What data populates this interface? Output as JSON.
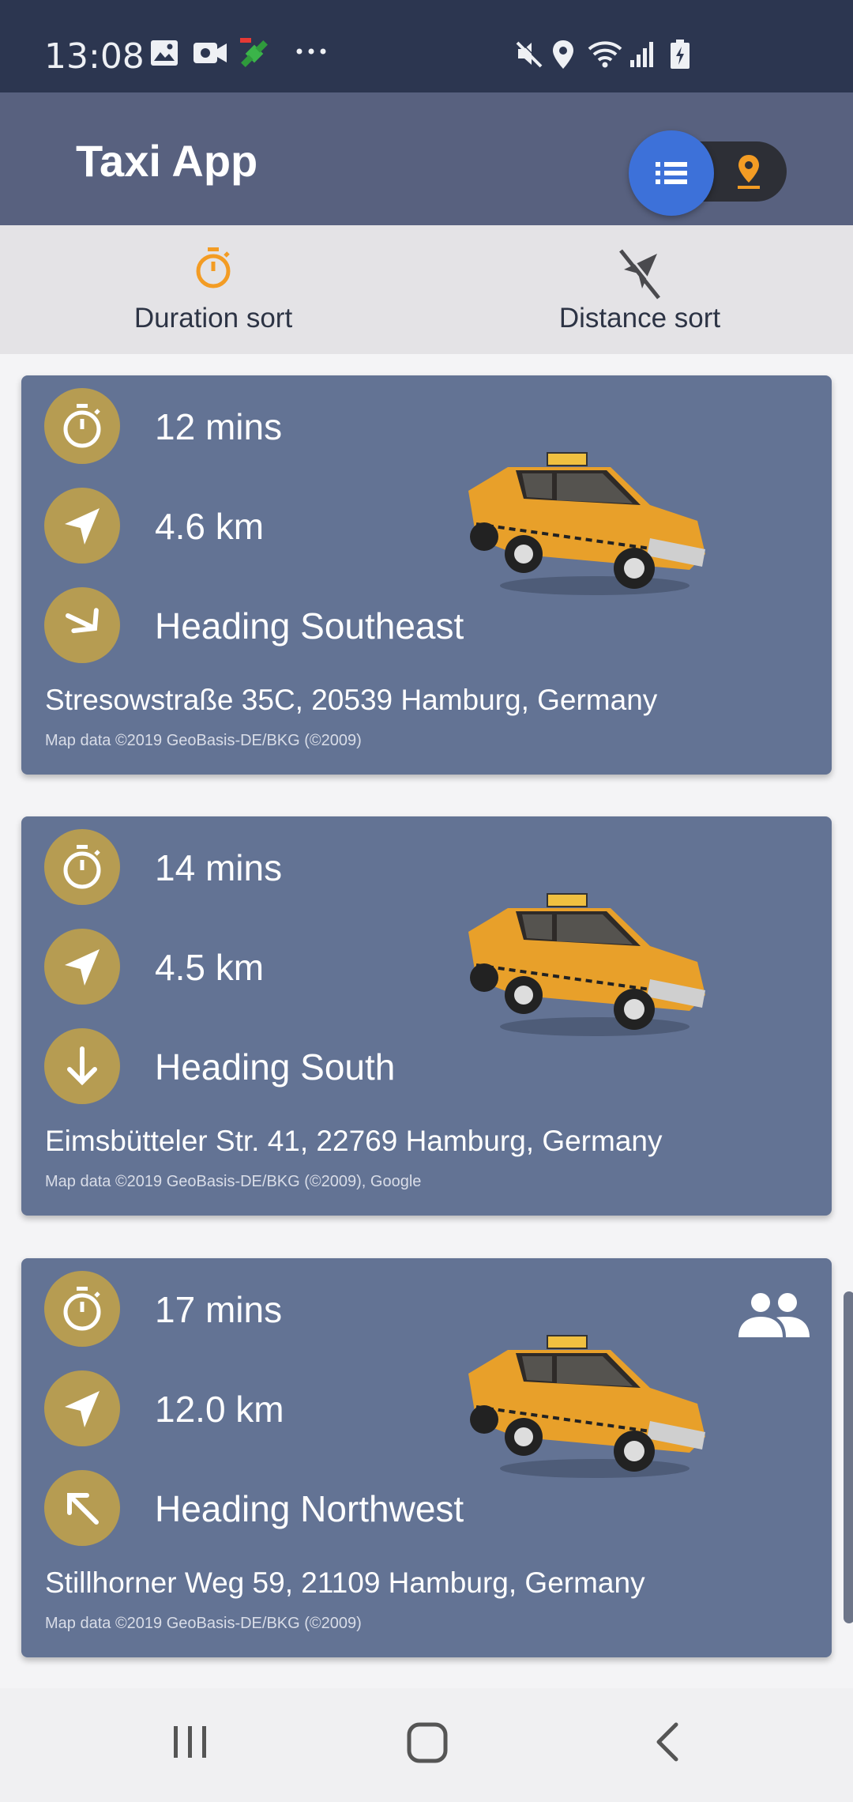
{
  "status_bar": {
    "time": "13:08",
    "left_icons": [
      "gallery-icon",
      "video-camera-icon",
      "satellite-icon",
      "more-dots-icon"
    ],
    "right_icons": [
      "mute-icon",
      "location-icon",
      "wifi-icon",
      "signal-icon",
      "battery-icon"
    ]
  },
  "app_bar": {
    "title": "Taxi App",
    "toggle": {
      "active": "list",
      "options": [
        "list-icon",
        "map-pin-icon"
      ]
    }
  },
  "sort": {
    "duration_label": "Duration sort",
    "distance_label": "Distance sort"
  },
  "colors": {
    "app_bar": "#58617f",
    "status_bar": "#2c3650",
    "card": "#637394",
    "circle": "#b69c52",
    "toggle_knob": "#3d71d9",
    "accent_orange": "#f39c24"
  },
  "taxis": [
    {
      "duration": "12 mins",
      "distance": "4.6 km",
      "heading": "Heading Southeast",
      "address": "Stresowstraße 35C, 20539 Hamburg, Germany",
      "credit": "Map data ©2019 GeoBasis-DE/BKG (©2009)",
      "group_icon": false
    },
    {
      "duration": "14 mins",
      "distance": "4.5 km",
      "heading": "Heading South",
      "address": "Eimsbütteler Str. 41, 22769 Hamburg, Germany",
      "credit": "Map data ©2019 GeoBasis-DE/BKG (©2009), Google",
      "group_icon": false
    },
    {
      "duration": "17 mins",
      "distance": "12.0 km",
      "heading": "Heading Northwest",
      "address": "Stillhorner Weg 59, 21109 Hamburg, Germany",
      "credit": "Map data ©2019 GeoBasis-DE/BKG (©2009)",
      "group_icon": true
    }
  ],
  "nav_bar": {
    "buttons": [
      "recents-icon",
      "home-icon",
      "back-icon"
    ]
  }
}
